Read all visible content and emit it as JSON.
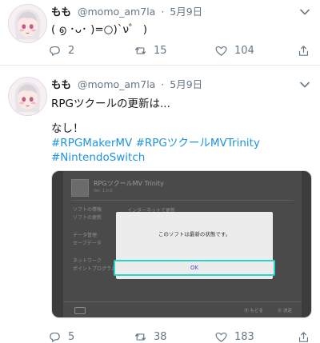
{
  "tweets": [
    {
      "display_name": "もも",
      "handle": "@momo_am7la",
      "separator": "·",
      "date": "5月9日",
      "text": "( ൭ ･ᴗ･ )=○)`ν゜ )",
      "reply_count": "2",
      "retweet_count": "15",
      "like_count": "104"
    },
    {
      "display_name": "もも",
      "handle": "@momo_am7la",
      "separator": "·",
      "date": "5月9日",
      "text_line1": "RPGツクールの更新は...",
      "text_line2": "なし！",
      "hashtags_line1": "#RPGMakerMV #RPGツクールMVTrinity",
      "hashtags_line2": "#NintendoSwitch",
      "reply_count": "5",
      "retweet_count": "38",
      "like_count": "183",
      "media": {
        "game_title": "RPGツクールMV Trinity",
        "game_subtitle": "Ver. 1.0.0",
        "menu_items": [
          "ソフトの情報",
          "ソフトの更新",
          "データ管理",
          "セーブデータ",
          "ネットワーク",
          "ポイントプログラム"
        ],
        "right_title": "インターネットで更新",
        "dialog_message": "このソフトは最新の状態です。",
        "dialog_button": "OK",
        "footer_back": "Ⓑ もどる",
        "footer_ok": "Ⓐ 決定"
      }
    }
  ],
  "colors": {
    "link": "#1b95e0",
    "muted": "#657786",
    "focus": "#2dd3c9"
  },
  "icons": [
    "reply-icon",
    "retweet-icon",
    "like-icon",
    "share-icon",
    "caret-down-icon"
  ]
}
